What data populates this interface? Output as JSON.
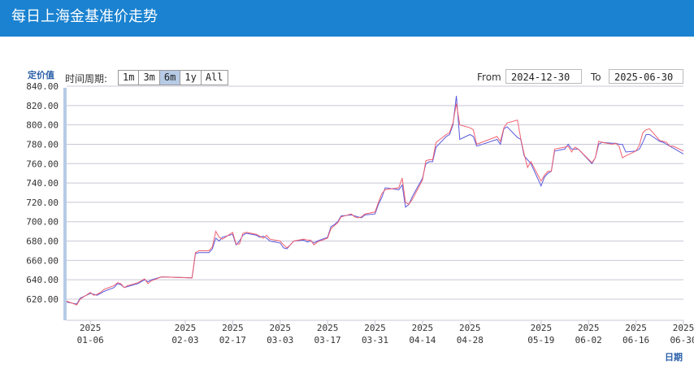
{
  "header": {
    "title": "每日上海金基准价走势"
  },
  "controls": {
    "zoom_label": "时间周期:",
    "zoom_buttons": [
      "1m",
      "3m",
      "6m",
      "1y",
      "All"
    ],
    "active_zoom": "6m",
    "from_label": "From",
    "from_value": "2024-12-30",
    "to_label": "To",
    "to_value": "2025-06-30"
  },
  "colors": {
    "header": "#1a82d0",
    "series_a": "#5a5adc",
    "series_b": "#f06070",
    "grid": "#c8c8d8"
  },
  "chart_data": {
    "type": "line",
    "title": "",
    "ylabel": "定价值",
    "xlabel": "日期",
    "ylim": [
      610,
      840
    ],
    "yticks": [
      "840.00",
      "820.00",
      "800.00",
      "780.00",
      "760.00",
      "740.00",
      "720.00",
      "700.00",
      "680.00",
      "660.00",
      "640.00",
      "620.00"
    ],
    "xticks": [
      {
        "year": "2025",
        "date": "01-06"
      },
      {
        "year": "2025",
        "date": "02-03"
      },
      {
        "year": "2025",
        "date": "02-17"
      },
      {
        "year": "2025",
        "date": "03-03"
      },
      {
        "year": "2025",
        "date": "03-17"
      },
      {
        "year": "2025",
        "date": "03-31"
      },
      {
        "year": "2025",
        "date": "04-14"
      },
      {
        "year": "2025",
        "date": "04-28"
      },
      {
        "year": "2025",
        "date": "05-19"
      },
      {
        "year": "2025",
        "date": "06-02"
      },
      {
        "year": "2025",
        "date": "06-16"
      },
      {
        "year": "2025",
        "date": "06-30"
      }
    ],
    "x": [
      "2024-12-30",
      "2025-01-02",
      "2025-01-03",
      "2025-01-06",
      "2025-01-07",
      "2025-01-08",
      "2025-01-09",
      "2025-01-10",
      "2025-01-13",
      "2025-01-14",
      "2025-01-15",
      "2025-01-16",
      "2025-01-17",
      "2025-01-20",
      "2025-01-21",
      "2025-01-22",
      "2025-01-23",
      "2025-01-24",
      "2025-01-27",
      "2025-02-05",
      "2025-02-06",
      "2025-02-07",
      "2025-02-10",
      "2025-02-11",
      "2025-02-12",
      "2025-02-13",
      "2025-02-14",
      "2025-02-17",
      "2025-02-18",
      "2025-02-19",
      "2025-02-20",
      "2025-02-21",
      "2025-02-24",
      "2025-02-25",
      "2025-02-26",
      "2025-02-27",
      "2025-02-28",
      "2025-03-03",
      "2025-03-04",
      "2025-03-05",
      "2025-03-06",
      "2025-03-07",
      "2025-03-10",
      "2025-03-11",
      "2025-03-12",
      "2025-03-13",
      "2025-03-14",
      "2025-03-17",
      "2025-03-18",
      "2025-03-19",
      "2025-03-20",
      "2025-03-21",
      "2025-03-24",
      "2025-03-25",
      "2025-03-26",
      "2025-03-27",
      "2025-03-28",
      "2025-03-31",
      "2025-04-01",
      "2025-04-02",
      "2025-04-03",
      "2025-04-07",
      "2025-04-08",
      "2025-04-09",
      "2025-04-10",
      "2025-04-11",
      "2025-04-14",
      "2025-04-15",
      "2025-04-16",
      "2025-04-17",
      "2025-04-18",
      "2025-04-21",
      "2025-04-22",
      "2025-04-23",
      "2025-04-24",
      "2025-04-25",
      "2025-04-28",
      "2025-04-29",
      "2025-04-30",
      "2025-05-06",
      "2025-05-07",
      "2025-05-08",
      "2025-05-09",
      "2025-05-12",
      "2025-05-13",
      "2025-05-14",
      "2025-05-15",
      "2025-05-16",
      "2025-05-19",
      "2025-05-20",
      "2025-05-21",
      "2025-05-22",
      "2025-05-23",
      "2025-05-26",
      "2025-05-27",
      "2025-05-28",
      "2025-05-29",
      "2025-05-30",
      "2025-06-03",
      "2025-06-04",
      "2025-06-05",
      "2025-06-06",
      "2025-06-09",
      "2025-06-10",
      "2025-06-11",
      "2025-06-12",
      "2025-06-13",
      "2025-06-16",
      "2025-06-17",
      "2025-06-18",
      "2025-06-19",
      "2025-06-20",
      "2025-06-23",
      "2025-06-24",
      "2025-06-25",
      "2025-06-26",
      "2025-06-27",
      "2025-06-30"
    ],
    "series": [
      {
        "values": [
          617,
          615,
          621,
          626,
          625,
          624,
          626,
          628,
          632,
          636,
          635,
          632,
          633,
          636,
          638,
          640,
          638,
          640,
          643,
          642,
          667,
          668,
          668,
          672,
          683,
          680,
          684,
          687,
          676,
          680,
          686,
          688,
          686,
          684,
          685,
          683,
          680,
          678,
          673,
          672,
          676,
          680,
          681,
          679,
          680,
          678,
          680,
          684,
          695,
          697,
          700,
          706,
          707,
          706,
          705,
          704,
          707,
          708,
          718,
          725,
          735,
          733,
          738,
          715,
          718,
          726,
          745,
          760,
          762,
          762,
          777,
          788,
          790,
          800,
          830,
          785,
          790,
          788,
          778,
          785,
          780,
          796,
          798,
          787,
          785,
          768,
          764,
          760,
          737,
          746,
          750,
          752,
          773,
          775,
          780,
          775,
          775,
          775,
          760,
          766,
          780,
          782,
          781,
          781,
          780,
          780,
          772,
          773,
          775,
          782,
          790,
          790,
          783,
          782,
          780,
          778,
          776,
          770,
          772,
          771,
          763,
          762
        ]
      },
      {
        "values": [
          618,
          614,
          620,
          627,
          624,
          625,
          627,
          630,
          634,
          637,
          636,
          632,
          634,
          637,
          639,
          641,
          636,
          639,
          643,
          642,
          668,
          670,
          670,
          674,
          690,
          684,
          682,
          689,
          677,
          677,
          688,
          689,
          687,
          685,
          683,
          686,
          682,
          680,
          676,
          673,
          676,
          680,
          682,
          681,
          681,
          676,
          679,
          683,
          693,
          696,
          699,
          705,
          708,
          705,
          704,
          705,
          708,
          710,
          720,
          729,
          733,
          735,
          745,
          720,
          718,
          723,
          743,
          763,
          764,
          764,
          782,
          790,
          792,
          802,
          822,
          800,
          797,
          795,
          780,
          788,
          783,
          797,
          802,
          805,
          786,
          770,
          756,
          762,
          742,
          748,
          752,
          752,
          775,
          777,
          778,
          772,
          777,
          775,
          761,
          766,
          783,
          782,
          780,
          781,
          778,
          766,
          768,
          773,
          779,
          792,
          795,
          796,
          784,
          783,
          782,
          778,
          778,
          773,
          773,
          771,
          766,
          761
        ]
      }
    ]
  }
}
